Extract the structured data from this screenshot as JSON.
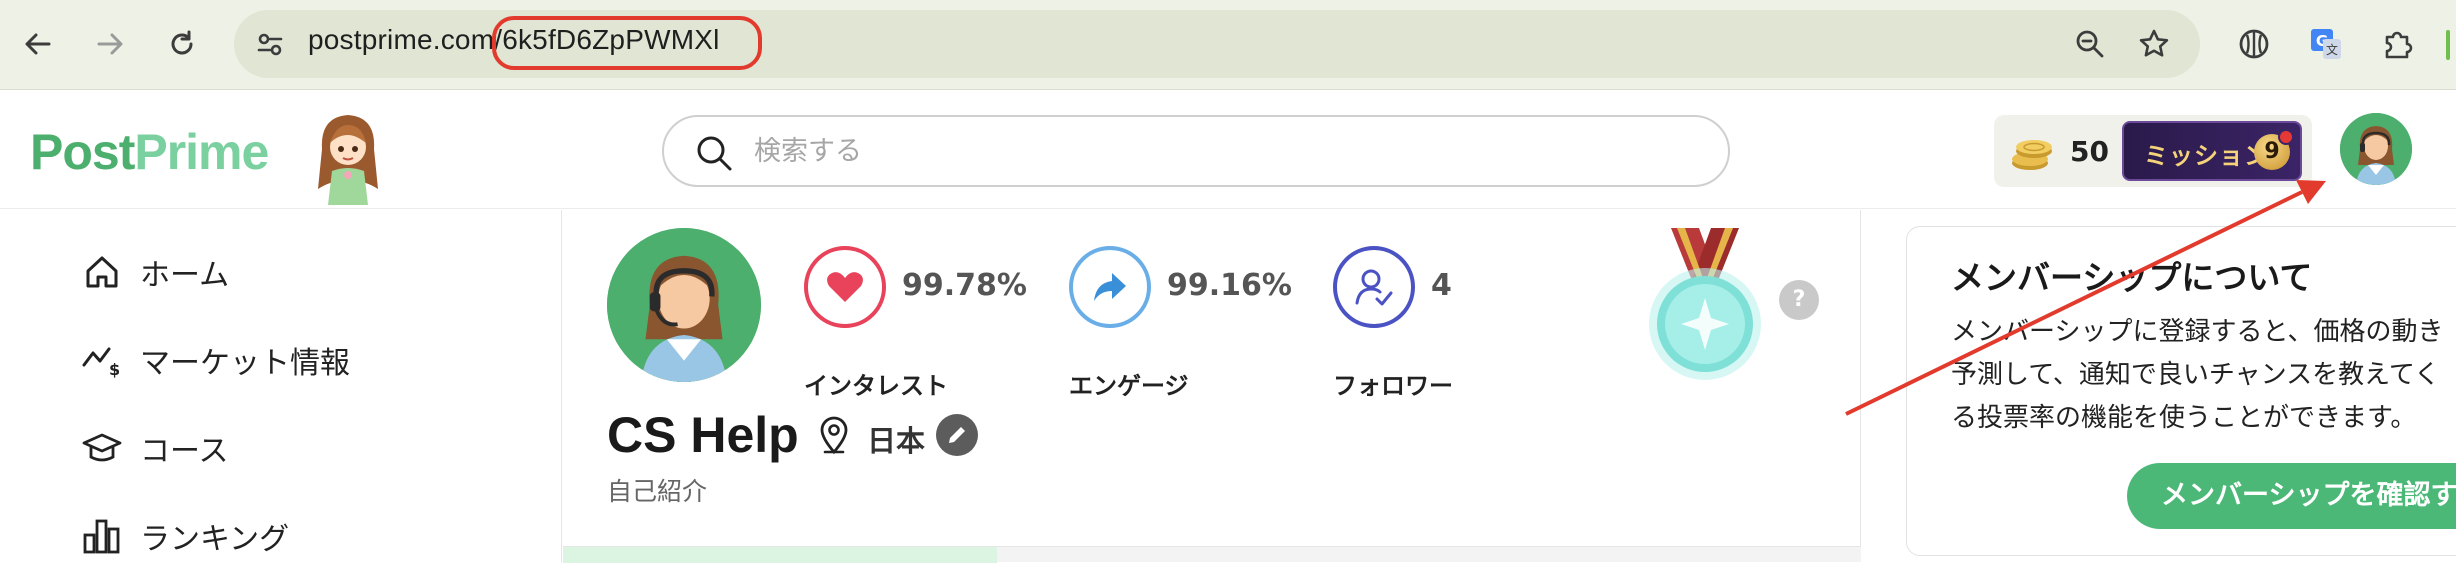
{
  "browser": {
    "url_host": "postprime.com",
    "url_path": "/6k5fD6ZpPWMXl",
    "icons": [
      "back-arrow-icon",
      "forward-arrow-icon",
      "reload-icon",
      "site-settings-icon",
      "zoom-out-icon",
      "bookmark-star-icon",
      "extension-shield-icon",
      "translate-icon",
      "extensions-puzzle-icon"
    ]
  },
  "header": {
    "logo_post": "Post",
    "logo_prime": "Prime",
    "search_placeholder": "検索する",
    "coins": "50",
    "mission_label": "ミッション",
    "mission_count": "9"
  },
  "sidebar": {
    "items": [
      {
        "label": "ホーム",
        "icon": "home-icon"
      },
      {
        "label": "マーケット情報",
        "icon": "market-trend-icon"
      },
      {
        "label": "コース",
        "icon": "graduation-cap-icon"
      },
      {
        "label": "ランキング",
        "icon": "ranking-bars-icon"
      }
    ]
  },
  "profile": {
    "stats": [
      {
        "value": "99.78%",
        "label": "インタレスト",
        "icon": "heart-icon",
        "color": "#e8435a"
      },
      {
        "value": "99.16%",
        "label": "エンゲージ",
        "icon": "share-arrow-icon",
        "color": "#3a8fd9"
      },
      {
        "value": "4",
        "label": "フォロワー",
        "icon": "follower-check-icon",
        "color": "#4a52c4"
      }
    ],
    "help_mark": "?",
    "name": "CS Help",
    "location": "日本",
    "bio": "自己紹介"
  },
  "membership": {
    "title": "メンバーシップについて",
    "body_lines": [
      "メンバーシップに登録すると、価格の動き",
      "予測して、通知で良いチャンスを教えてく",
      "る投票率の機能を使うことができます。"
    ],
    "button_label": "メンバーシップを確認する"
  },
  "colors": {
    "brand_green": "#4caf6e",
    "annotation_red": "#e23b2d",
    "chrome_bg": "#eef1e6"
  }
}
